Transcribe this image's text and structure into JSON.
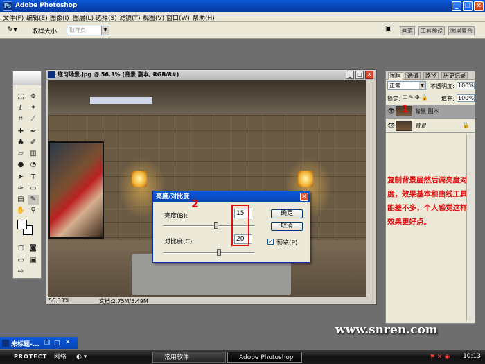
{
  "app": {
    "title": "Adobe Photoshop"
  },
  "menu": [
    "文件(F)",
    "编辑(E)",
    "图像(I)",
    "图层(L)",
    "选择(S)",
    "滤镜(T)",
    "视图(V)",
    "窗口(W)",
    "帮助(H)"
  ],
  "options": {
    "sample_size_label": "取样大小:",
    "sample_size_value": "取样点",
    "palette_tabs": [
      "画笔",
      "工具预设",
      "图层复合"
    ]
  },
  "document": {
    "title": "练习场景.jpg @ 56.3% (背景 副本, RGB/8#)",
    "zoom": "56.33%",
    "doc_size": "文档:2.75M/5.49M"
  },
  "dialog": {
    "title": "亮度/对比度",
    "brightness_label": "亮度(B):",
    "brightness_value": "15",
    "contrast_label": "对比度(C):",
    "contrast_value": "20",
    "ok": "确定",
    "cancel": "取消",
    "preview_label": "预览(P)",
    "preview_checked": true
  },
  "layers_panel": {
    "tabs": [
      "图层",
      "通道",
      "路径",
      "历史记录"
    ],
    "blend_mode": "正常",
    "opacity_label": "不透明度:",
    "opacity_value": "100%",
    "lock_label": "锁定:",
    "fill_label": "填充:",
    "fill_value": "100%",
    "layers": [
      {
        "name": "背景 副本",
        "selected": true
      },
      {
        "name": "背景",
        "locked": true
      }
    ]
  },
  "annotation": {
    "text": "复制背景层然后调亮度对比度，效果基本和曲线工具功能差不多，个人感觉这样的效果更好点。",
    "num1": "1",
    "num2": "2"
  },
  "minimized_doc": {
    "title": "未标题-..."
  },
  "watermark": "www.snren.com",
  "taskbar": {
    "protect": "PROTECT",
    "network": "网络",
    "items": [
      "常用软件",
      "Adobe Photoshop"
    ],
    "clock": "10:13"
  }
}
